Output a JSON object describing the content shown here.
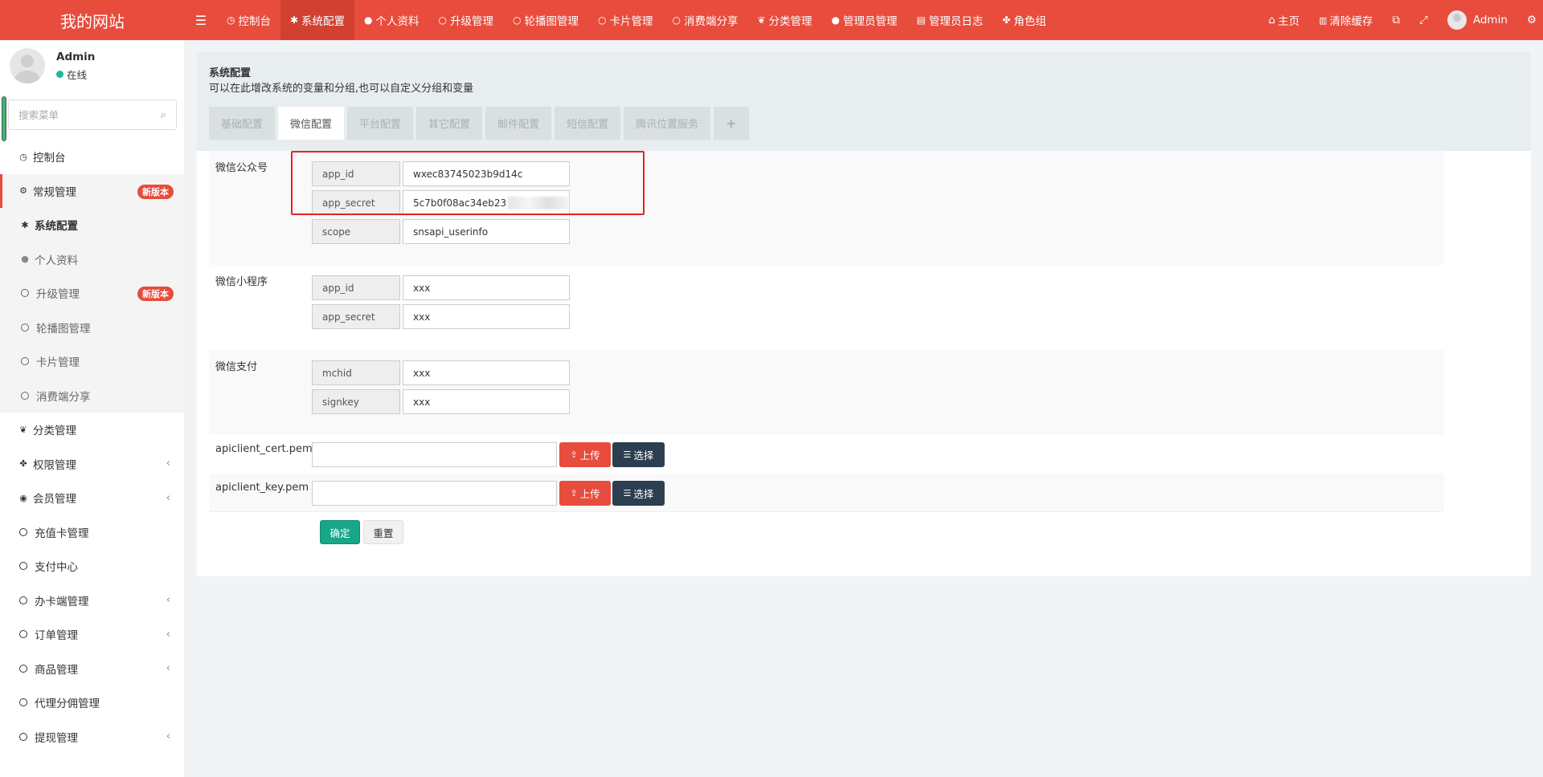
{
  "header": {
    "logo": "我的网站",
    "toggle_icon": "☰",
    "nav": [
      {
        "icon": "dashboard-icon",
        "glyph": "◷",
        "label": "控制台"
      },
      {
        "icon": "gear-icon",
        "glyph": "✱",
        "label": "系统配置",
        "active": true
      },
      {
        "icon": "user-icon",
        "glyph": "●",
        "label": "个人资料"
      },
      {
        "icon": "circle-icon",
        "glyph": "○",
        "label": "升级管理"
      },
      {
        "icon": "circle-icon",
        "glyph": "○",
        "label": "轮播图管理"
      },
      {
        "icon": "circle-icon",
        "glyph": "○",
        "label": "卡片管理"
      },
      {
        "icon": "circle-icon",
        "glyph": "○",
        "label": "消费端分享"
      },
      {
        "icon": "leaf-icon",
        "glyph": "❦",
        "label": "分类管理"
      },
      {
        "icon": "user-icon",
        "glyph": "●",
        "label": "管理员管理"
      },
      {
        "icon": "list-icon",
        "glyph": "▤",
        "label": "管理员日志"
      },
      {
        "icon": "group-icon",
        "glyph": "✤",
        "label": "角色组"
      }
    ],
    "right": {
      "home_label": "主页",
      "home_glyph": "⌂",
      "clear_cache_label": "清除缓存",
      "clear_cache_glyph": "▥",
      "translate_glyph": "⧉",
      "fullscreen_glyph": "⤢",
      "admin_name": "Admin",
      "settings_glyph": "⚙"
    }
  },
  "sidebar": {
    "user_name": "Admin",
    "status": "在线",
    "search_placeholder": "搜索菜单",
    "search_glyph": "⌕",
    "items": [
      {
        "label": "控制台",
        "glyph": "◷"
      },
      {
        "label": "常规管理",
        "glyph": "⚙",
        "badge": "新版本"
      },
      {
        "label": "系统配置",
        "glyph": "✱"
      },
      {
        "label": "个人资料",
        "glyph": "●"
      },
      {
        "label": "升级管理",
        "badge": "新版本"
      },
      {
        "label": "轮播图管理"
      },
      {
        "label": "卡片管理"
      },
      {
        "label": "消费端分享"
      },
      {
        "label": "分类管理",
        "glyph": "❦"
      },
      {
        "label": "权限管理",
        "glyph": "✤"
      },
      {
        "label": "会员管理",
        "glyph": "◉"
      },
      {
        "label": "充值卡管理"
      },
      {
        "label": "支付中心"
      },
      {
        "label": "办卡端管理"
      },
      {
        "label": "订单管理"
      },
      {
        "label": "商品管理"
      },
      {
        "label": "代理分佣管理"
      },
      {
        "label": "提现管理"
      }
    ],
    "chevron": "‹"
  },
  "content": {
    "title": "系统配置",
    "description": "可以在此增改系统的变量和分组,也可以自定义分组和变量",
    "tabs": [
      "基础配置",
      "微信配置",
      "平台配置",
      "其它配置",
      "邮件配置",
      "短信配置",
      "腾讯位置服务",
      "+"
    ],
    "active_tab": "微信配置",
    "groups": [
      {
        "label": "微信公众号",
        "fields": [
          {
            "key": "app_id",
            "value": "wxec83745023b9d14c"
          },
          {
            "key": "app_secret",
            "value": "5c7b0f08ac34eb23"
          },
          {
            "key": "scope",
            "value": "snsapi_userinfo"
          }
        ]
      },
      {
        "label": "微信小程序",
        "fields": [
          {
            "key": "app_id",
            "value": "xxx"
          },
          {
            "key": "app_secret",
            "value": "xxx"
          }
        ]
      },
      {
        "label": "微信支付",
        "fields": [
          {
            "key": "mchid",
            "value": "xxx"
          },
          {
            "key": "signkey",
            "value": "xxx"
          }
        ]
      }
    ],
    "files": [
      {
        "label": "apiclient_cert.pem",
        "value": ""
      },
      {
        "label": "apiclient_key.pem",
        "value": ""
      }
    ],
    "upload_label": "上传",
    "upload_glyph": "⇪",
    "choose_label": "选择",
    "choose_glyph": "☰",
    "submit_label": "确定",
    "reset_label": "重置"
  },
  "colors": {
    "header_bg": "#e74c3c",
    "active_nav": "#d24032",
    "success": "#18a689",
    "dark": "#2c3e50",
    "highlight_box": "#e02424"
  }
}
